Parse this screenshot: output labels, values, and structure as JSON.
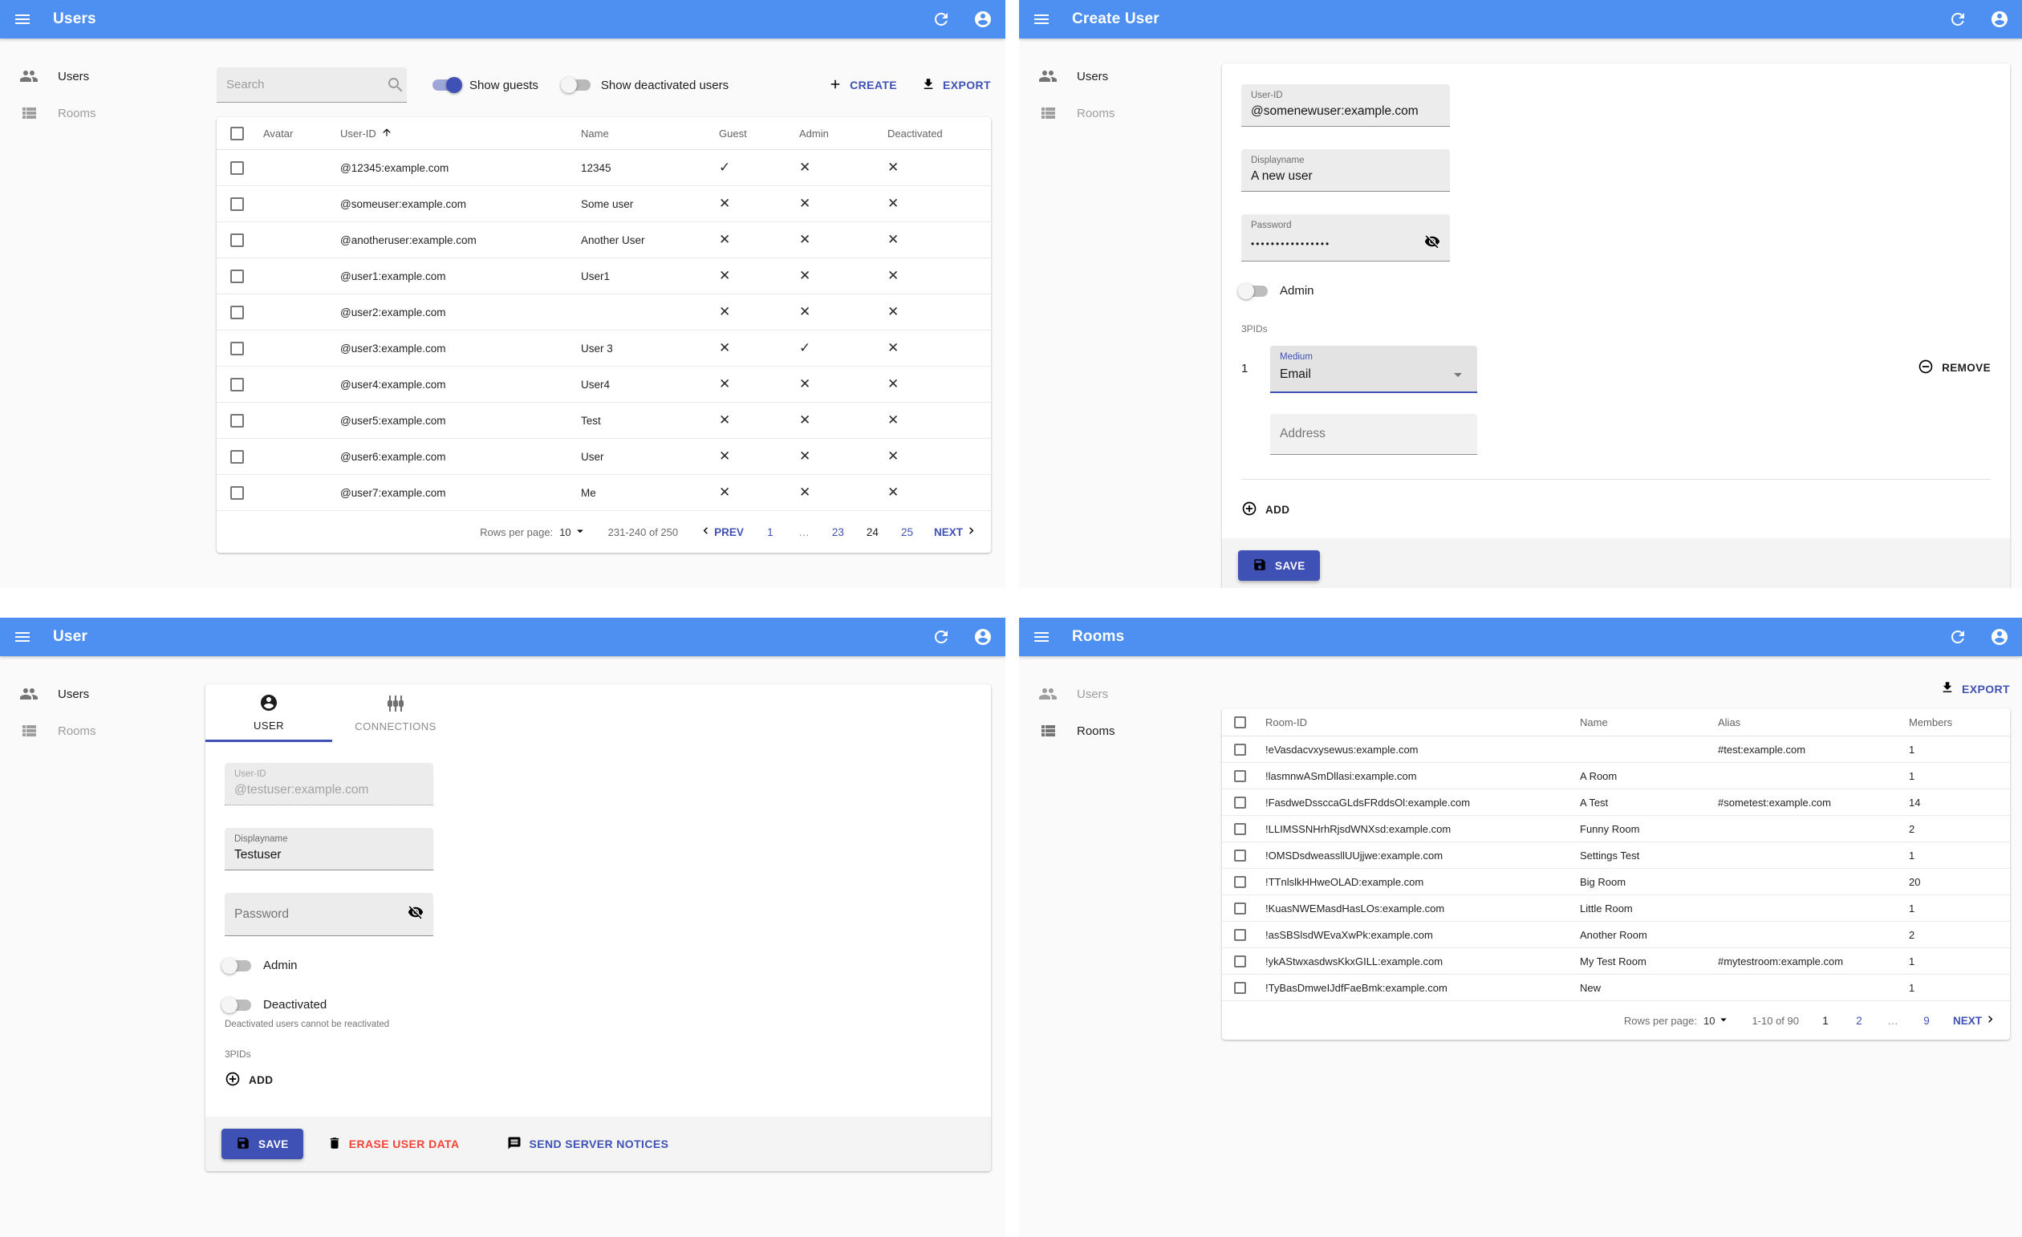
{
  "glyphs": {
    "check": "✓",
    "cross": "✕"
  },
  "colors": {
    "app_bar": "#4d90f2",
    "primary": "#3f51b5",
    "danger": "#f44336"
  },
  "panels": {
    "users_list": {
      "title": "Users",
      "sidebar": {
        "users": "Users",
        "rooms": "Rooms"
      },
      "search_placeholder": "Search",
      "show_guests": {
        "label": "Show guests",
        "on": true
      },
      "show_deactivated": {
        "label": "Show deactivated users",
        "on": false
      },
      "create_label": "CREATE",
      "export_label": "EXPORT",
      "table": {
        "columns": {
          "avatar": "Avatar",
          "user_id": "User-ID",
          "name": "Name",
          "guest": "Guest",
          "admin": "Admin",
          "deactivated": "Deactivated"
        },
        "rows": [
          {
            "user_id": "@12345:example.com",
            "name": "12345",
            "guest": true,
            "admin": false,
            "deactivated": false
          },
          {
            "user_id": "@someuser:example.com",
            "name": "Some user",
            "guest": false,
            "admin": false,
            "deactivated": false
          },
          {
            "user_id": "@anotheruser:example.com",
            "name": "Another User",
            "guest": false,
            "admin": false,
            "deactivated": false
          },
          {
            "user_id": "@user1:example.com",
            "name": "User1",
            "guest": false,
            "admin": false,
            "deactivated": false
          },
          {
            "user_id": "@user2:example.com",
            "name": "",
            "guest": false,
            "admin": false,
            "deactivated": false
          },
          {
            "user_id": "@user3:example.com",
            "name": "User 3",
            "guest": false,
            "admin": true,
            "deactivated": false
          },
          {
            "user_id": "@user4:example.com",
            "name": "User4",
            "guest": false,
            "admin": false,
            "deactivated": false
          },
          {
            "user_id": "@user5:example.com",
            "name": "Test",
            "guest": false,
            "admin": false,
            "deactivated": false
          },
          {
            "user_id": "@user6:example.com",
            "name": "User",
            "guest": false,
            "admin": false,
            "deactivated": false
          },
          {
            "user_id": "@user7:example.com",
            "name": "Me",
            "guest": false,
            "admin": false,
            "deactivated": false
          }
        ]
      },
      "pagination": {
        "rows_per_page_label": "Rows per page:",
        "rows_per_page": "10",
        "range": "231-240 of 250",
        "prev": "PREV",
        "next": "NEXT",
        "pages": [
          {
            "label": "1",
            "type": "link"
          },
          {
            "label": "…",
            "type": "ellipsis"
          },
          {
            "label": "23",
            "type": "link"
          },
          {
            "label": "24",
            "type": "current"
          },
          {
            "label": "25",
            "type": "link"
          }
        ]
      }
    },
    "create_user": {
      "title": "Create User",
      "sidebar": {
        "users": "Users",
        "rooms": "Rooms"
      },
      "fields": {
        "user_id": {
          "label": "User-ID",
          "value": "@somenewuser:example.com"
        },
        "displayname": {
          "label": "Displayname",
          "value": "A new user"
        },
        "password": {
          "label": "Password",
          "value": "••••••••••••••••"
        }
      },
      "admin_toggle": {
        "label": "Admin",
        "on": false
      },
      "threepids": {
        "section_label": "3PIDs",
        "index": "1",
        "medium_label": "Medium",
        "medium_value": "Email",
        "address_placeholder": "Address",
        "remove_label": "REMOVE",
        "add_label": "ADD"
      },
      "save_label": "SAVE"
    },
    "user_edit": {
      "title": "User",
      "sidebar": {
        "users": "Users",
        "rooms": "Rooms"
      },
      "tabs": {
        "user": "USER",
        "connections": "CONNECTIONS"
      },
      "fields": {
        "user_id": {
          "label": "User-ID",
          "value": "@testuser:example.com"
        },
        "displayname": {
          "label": "Displayname",
          "value": "Testuser"
        },
        "password": {
          "label": "Password",
          "value": ""
        }
      },
      "admin_toggle": {
        "label": "Admin",
        "on": false
      },
      "deactivated_toggle": {
        "label": "Deactivated",
        "on": false
      },
      "deactivated_help": "Deactivated users cannot be reactivated",
      "threepids_label": "3PIDs",
      "add_label": "ADD",
      "save_label": "SAVE",
      "erase_label": "ERASE USER DATA",
      "notices_label": "SEND SERVER NOTICES"
    },
    "rooms_list": {
      "title": "Rooms",
      "sidebar": {
        "users": "Users",
        "rooms": "Rooms"
      },
      "export_label": "EXPORT",
      "table": {
        "columns": {
          "room_id": "Room-ID",
          "name": "Name",
          "alias": "Alias",
          "members": "Members"
        },
        "rows": [
          {
            "room_id": "!eVasdacvxysewus:example.com",
            "name": "",
            "alias": "#test:example.com",
            "members": "1"
          },
          {
            "room_id": "!lasmnwASmDllasi:example.com",
            "name": "A Room",
            "alias": "",
            "members": "1"
          },
          {
            "room_id": "!FasdweDssccaGLdsFRddsOl:example.com",
            "name": "A Test",
            "alias": "#sometest:example.com",
            "members": "14"
          },
          {
            "room_id": "!LLIMSSNHrhRjsdWNXsd:example.com",
            "name": "Funny Room",
            "alias": "",
            "members": "2"
          },
          {
            "room_id": "!OMSDsdweassllUUjjwe:example.com",
            "name": "Settings Test",
            "alias": "",
            "members": "1"
          },
          {
            "room_id": "!TTnlslkHHweOLAD:example.com",
            "name": "Big Room",
            "alias": "",
            "members": "20"
          },
          {
            "room_id": "!KuasNWEMasdHasLOs:example.com",
            "name": "Little Room",
            "alias": "",
            "members": "1"
          },
          {
            "room_id": "!asSBSlsdWEvaXwPk:example.com",
            "name": "Another Room",
            "alias": "",
            "members": "2"
          },
          {
            "room_id": "!ykAStwxasdwsKkxGILL:example.com",
            "name": "My Test Room",
            "alias": "#mytestroom:example.com",
            "members": "1"
          },
          {
            "room_id": "!TyBasDmweIJdfFaeBmk:example.com",
            "name": "New",
            "alias": "",
            "members": "1"
          }
        ]
      },
      "pagination": {
        "rows_per_page_label": "Rows per page:",
        "rows_per_page": "10",
        "range": "1-10 of 90",
        "next": "NEXT",
        "pages": [
          {
            "label": "1",
            "type": "current"
          },
          {
            "label": "2",
            "type": "link"
          },
          {
            "label": "…",
            "type": "ellipsis"
          },
          {
            "label": "9",
            "type": "link"
          }
        ]
      }
    }
  }
}
